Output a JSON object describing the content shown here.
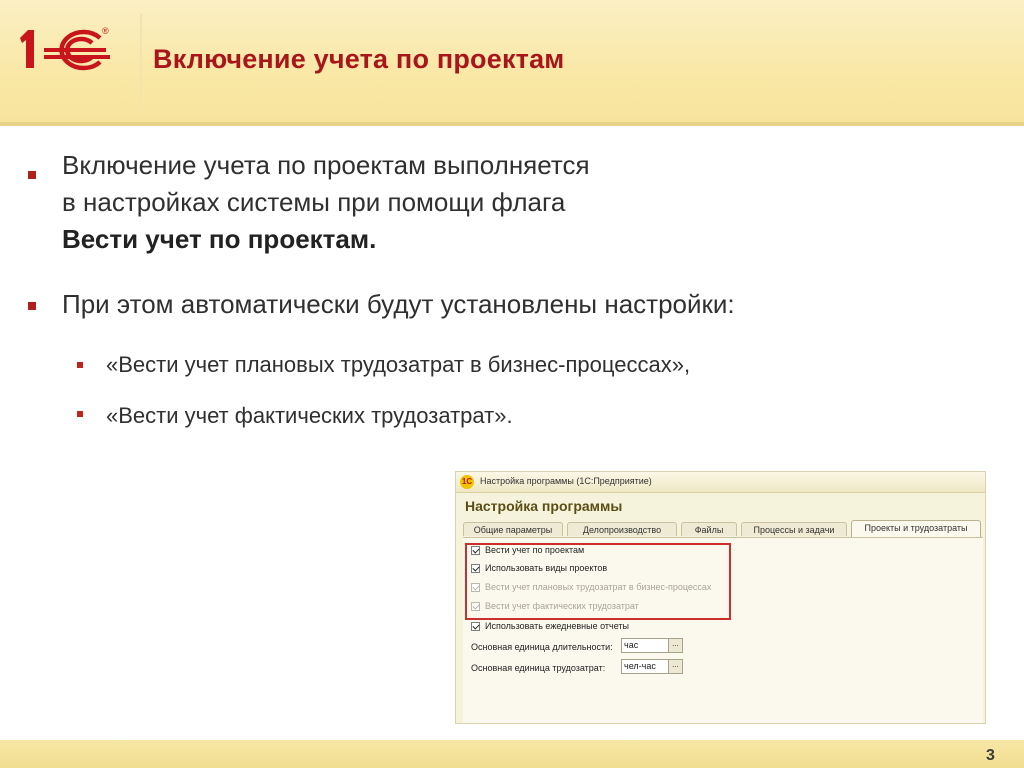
{
  "slide": {
    "title": "Включение учета по проектам",
    "page_number": "3"
  },
  "logo": {
    "text": "1С",
    "registered": "®"
  },
  "bullets": {
    "b1_line1": "Включение учета по проектам выполняется",
    "b1_line2": "в настройках системы при помощи флага",
    "b1_bold": "Вести учет по проектам.",
    "b2": "При этом автоматически будут установлены настройки:",
    "sub1": "«Вести учет плановых трудозатрат в бизнес-процессах»,",
    "sub2": "«Вести учет фактических трудозатрат»."
  },
  "screenshot": {
    "window_title": "Настройка программы  (1С:Предприятие)",
    "heading": "Настройка программы",
    "tabs": [
      "Общие параметры",
      "Делопроизводство",
      "Файлы",
      "Процессы и задачи",
      "Проекты и трудозатраты"
    ],
    "active_tab": "Проекты и трудозатраты",
    "checkboxes": [
      {
        "label": "Вести учет по проектам",
        "checked": true,
        "enabled": true
      },
      {
        "label": "Использовать виды проектов",
        "checked": true,
        "enabled": true
      },
      {
        "label": "Вести учет плановых трудозатрат в бизнес-процессах",
        "checked": true,
        "enabled": false
      },
      {
        "label": "Вести учет фактических трудозатрат",
        "checked": true,
        "enabled": false
      },
      {
        "label": "Использовать ежедневные отчеты",
        "checked": true,
        "enabled": true
      }
    ],
    "fields": {
      "duration_label": "Основная единица длительности:",
      "duration_value": "час",
      "labor_label": "Основная единица трудозатрат:",
      "labor_value": "чел-час",
      "choose_button": "..."
    }
  },
  "colors": {
    "title_red": "#a8151b",
    "bullet_red": "#b0211c",
    "highlight_red": "#cc2f2a",
    "header_yellow": "#f9e8a8"
  }
}
